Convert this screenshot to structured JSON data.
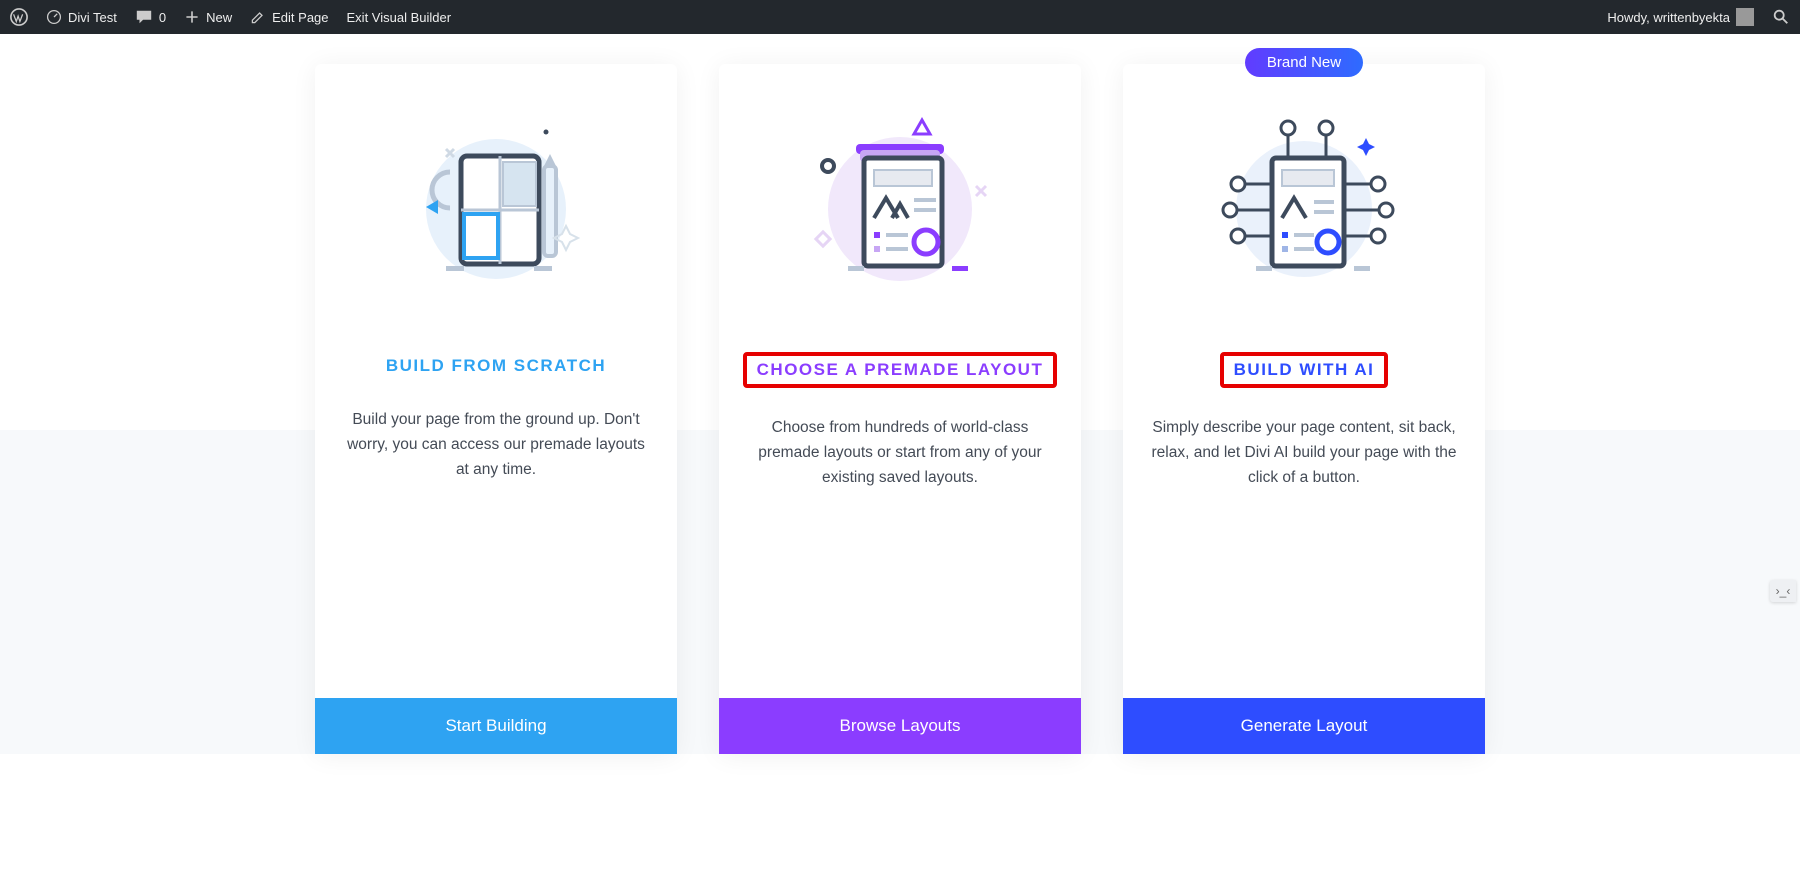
{
  "adminbar": {
    "site_name": "Divi Test",
    "comment_count": "0",
    "new_label": "New",
    "edit_page": "Edit Page",
    "exit_builder": "Exit Visual Builder",
    "greeting": "Howdy, writtenbyekta"
  },
  "badge_label": "Brand New",
  "cards": {
    "scratch": {
      "title": "BUILD FROM SCRATCH",
      "desc": "Build your page from the ground up. Don't worry, you can access our premade layouts at any time.",
      "button": "Start Building",
      "title_color": "#2ea3f2",
      "btn_color": "#2ea3f2",
      "highlighted": false
    },
    "premade": {
      "title": "CHOOSE A PREMADE LAYOUT",
      "desc": "Choose from hundreds of world-class premade layouts or start from any of your existing saved layouts.",
      "button": "Browse Layouts",
      "title_color": "#8b3dff",
      "btn_color": "#8b3dff",
      "highlighted": true
    },
    "ai": {
      "title": "BUILD WITH AI",
      "desc": "Simply describe your page content, sit back, relax, and let Divi AI build your page with the click of a button.",
      "button": "Generate Layout",
      "title_color": "#2e4dff",
      "btn_color": "#2e4dff",
      "highlighted": true
    }
  }
}
